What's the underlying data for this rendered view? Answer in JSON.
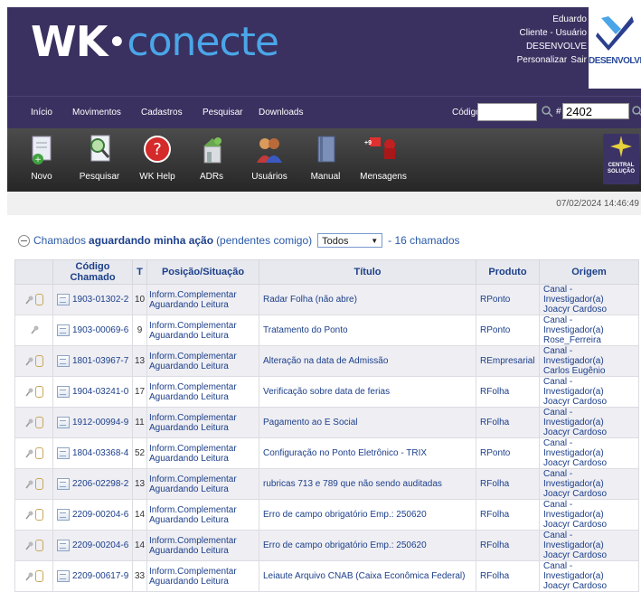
{
  "header": {
    "logo_wk": "WK",
    "logo_dot": "•",
    "logo_conecte": "conecte",
    "user": {
      "name": "Eduardo",
      "role": "Cliente - Usuário",
      "company": "DESENVOLVE",
      "personalizar": "Personalizar",
      "sair": "Sair"
    },
    "brand": {
      "text": "DESENVOLVE"
    },
    "colors": {
      "header_bg": "#3a3160",
      "logo_accent": "#4aa6e8"
    }
  },
  "menu": {
    "items": [
      "Início",
      "Movimentos",
      "Cadastros",
      "Pesquisar",
      "Downloads"
    ],
    "codigo_label": "Código",
    "codigo_value": "",
    "hash": "#",
    "number_value": "2402"
  },
  "toolbar": {
    "buttons": [
      {
        "label": "Novo",
        "icon": "new-document-icon"
      },
      {
        "label": "Pesquisar",
        "icon": "search-document-icon"
      },
      {
        "label": "WK Help",
        "icon": "help-icon"
      },
      {
        "label": "ADRs",
        "icon": "adr-icon"
      },
      {
        "label": "Usuários",
        "icon": "users-icon"
      },
      {
        "label": "Manual",
        "icon": "manual-book-icon"
      },
      {
        "label": "Mensagens",
        "icon": "messages-icon",
        "badge": "+9"
      }
    ],
    "central": {
      "line1": "CENTRAL",
      "line2": "SOLUÇÃO"
    }
  },
  "datetime": "07/02/2024 14:46:49",
  "filter": {
    "prefix": "Chamados",
    "bold": "aguardando minha ação",
    "suffix": "(pendentes comigo)",
    "select_value": "Todos",
    "count_text": "- 16 chamados"
  },
  "table": {
    "headers": [
      "",
      "Código Chamado",
      "T",
      "Posição/Situação",
      "Título",
      "Produto",
      "Origem"
    ],
    "rows": [
      {
        "codigo": "1903-01302-2",
        "t": "10",
        "pos1": "Inform.Complementar",
        "pos2": "Aguardando Leitura",
        "titulo": "Radar Folha (não abre)",
        "produto": "RPonto",
        "orig1": "Canal - Investigador(a)",
        "orig2": "Joacyr Cardoso",
        "clip": true
      },
      {
        "codigo": "1903-00069-6",
        "t": "9",
        "pos1": "Inform.Complementar",
        "pos2": "Aguardando Leitura",
        "titulo": "Tratamento do Ponto",
        "produto": "RPonto",
        "orig1": "Canal - Investigador(a)",
        "orig2": "Rose_Ferreira",
        "clip": false
      },
      {
        "codigo": "1801-03967-7",
        "t": "13",
        "pos1": "Inform.Complementar",
        "pos2": "Aguardando Leitura",
        "titulo": "Alteração na data de Admissão",
        "produto": "REmpresarial",
        "orig1": "Canal - Investigador(a)",
        "orig2": "Carlos Eugênio",
        "clip": true
      },
      {
        "codigo": "1904-03241-0",
        "t": "17",
        "pos1": "Inform.Complementar",
        "pos2": "Aguardando Leitura",
        "titulo": "Verificação sobre data de ferias",
        "produto": "RFolha",
        "orig1": "Canal - Investigador(a)",
        "orig2": "Joacyr Cardoso",
        "clip": true
      },
      {
        "codigo": "1912-00994-9",
        "t": "11",
        "pos1": "Inform.Complementar",
        "pos2": "Aguardando Leitura",
        "titulo": "Pagamento ao E Social",
        "produto": "RFolha",
        "orig1": "Canal - Investigador(a)",
        "orig2": "Joacyr Cardoso",
        "clip": true
      },
      {
        "codigo": "1804-03368-4",
        "t": "52",
        "pos1": "Inform.Complementar",
        "pos2": "Aguardando Leitura",
        "titulo": "Configuração no Ponto Eletrônico - TRIX",
        "produto": "RPonto",
        "orig1": "Canal - Investigador(a)",
        "orig2": "Joacyr Cardoso",
        "clip": true
      },
      {
        "codigo": "2206-02298-2",
        "t": "13",
        "pos1": "Inform.Complementar",
        "pos2": "Aguardando Leitura",
        "titulo": "rubricas 713 e 789 que não sendo auditadas",
        "produto": "RFolha",
        "orig1": "Canal - Investigador(a)",
        "orig2": "Joacyr Cardoso",
        "clip": true
      },
      {
        "codigo": "2209-00204-6",
        "t": "14",
        "pos1": "Inform.Complementar",
        "pos2": "Aguardando Leitura",
        "titulo": "Erro de campo obrigatório Emp.: 250620",
        "produto": "RFolha",
        "orig1": "Canal - Investigador(a)",
        "orig2": "Joacyr Cardoso",
        "clip": true
      },
      {
        "codigo": "2209-00204-6",
        "t": "14",
        "pos1": "Inform.Complementar",
        "pos2": "Aguardando Leitura",
        "titulo": "Erro de campo obrigatório Emp.: 250620",
        "produto": "RFolha",
        "orig1": "Canal - Investigador(a)",
        "orig2": "Joacyr Cardoso",
        "clip": true
      },
      {
        "codigo": "2209-00617-9",
        "t": "33",
        "pos1": "Inform.Complementar",
        "pos2": "Aguardando Leitura",
        "titulo": "Leiaute Arquivo CNAB (Caixa Econômica Federal)",
        "produto": "RFolha",
        "orig1": "Canal - Investigador(a)",
        "orig2": "Joacyr Cardoso",
        "clip": true
      }
    ]
  }
}
